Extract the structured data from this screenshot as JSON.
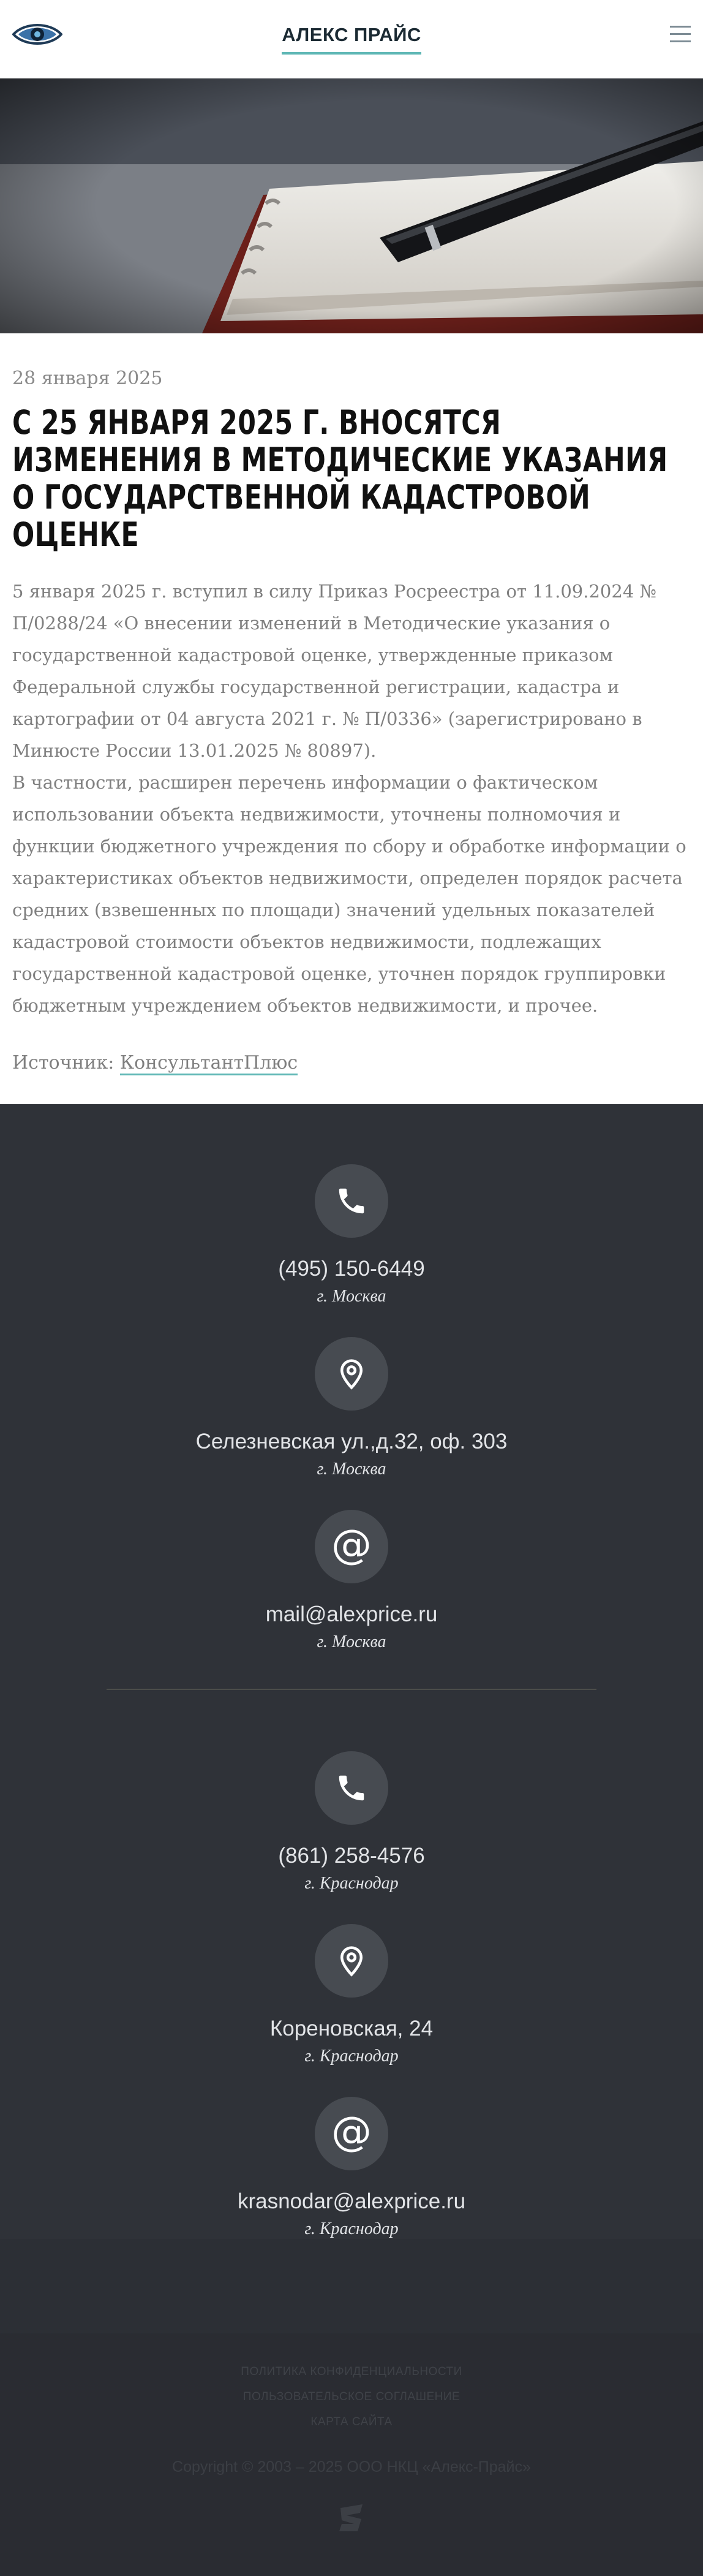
{
  "header": {
    "brand": "АЛЕКС ПРАЙС",
    "logo_icon": "eye-logo-icon",
    "menu_icon": "hamburger-menu-icon"
  },
  "hero": {
    "description_icon": "notebook-pen-photo"
  },
  "article": {
    "date": "28 января 2025",
    "title": "С 25 ЯНВАРЯ 2025 Г. ВНОСЯТСЯ ИЗМЕНЕНИЯ В МЕТОДИЧЕСКИЕ УКАЗАНИЯ О ГОСУДАРСТВЕННОЙ КАДАСТРОВОЙ ОЦЕНКЕ",
    "paragraph1": "5 января 2025 г. вступил в силу Приказ Росреестра от 11.09.2024 № П/0288/24 «О внесении изменений в Методические указания о государственной кадастровой оценке, утвержденные приказом Федеральной службы государственной регистрации, кадастра и картографии от 04 августа 2021 г. № П/0336» (зарегистрировано в Минюсте России 13.01.2025 № 80897).",
    "paragraph2": "В частности, расширен перечень информации о фактическом использовании объекта недвижимости, уточнены полномочия и функции бюджетного учреждения по сбору и обработке информации о характеристиках объектов недвижимости, определен порядок расчета средних (взвешенных по площади) значений удельных показателей кадастровой стоимости объектов недвижимости, подлежащих государственной кадастровой оценке, уточнен порядок группировки бюджетным учреждением объектов недвижимости, и прочее.",
    "source_label": "Источник:",
    "source_link": "КонсультантПлюс"
  },
  "contacts": {
    "moscow": [
      {
        "icon": "phone-icon",
        "value": "(495) 150-6449",
        "city": "г. Москва"
      },
      {
        "icon": "location-pin-icon",
        "value": "Селезневская ул.,д.32, оф. 303",
        "city": "г. Москва"
      },
      {
        "icon": "at-sign-icon",
        "value": "mail@alexprice.ru",
        "city": "г. Москва"
      }
    ],
    "krasnodar": [
      {
        "icon": "phone-icon",
        "value": "(861) 258-4576",
        "city": "г. Краснодар"
      },
      {
        "icon": "location-pin-icon",
        "value": "Кореновская, 24",
        "city": "г. Краснодар"
      },
      {
        "icon": "at-sign-icon",
        "value": "krasnodar@alexprice.ru",
        "city": "г. Краснодар"
      }
    ]
  },
  "footer": {
    "links": [
      "ПОЛИТИКА КОНФИДЕНЦИАЛЬНОСТИ",
      "ПОЛЬЗОВАТЕЛЬСКОЕ СОГЛАШЕНИЕ",
      "КАРТА САЙТА"
    ],
    "copyright": "Copyright © 2003 – 2025 ООО НКЦ «Алекс-Прайс»",
    "logo_icon": "developer-logo-icon"
  },
  "colors": {
    "accent": "#5fb7b5",
    "dark_bg": "#2f3238",
    "icon_circle": "#474b51"
  }
}
